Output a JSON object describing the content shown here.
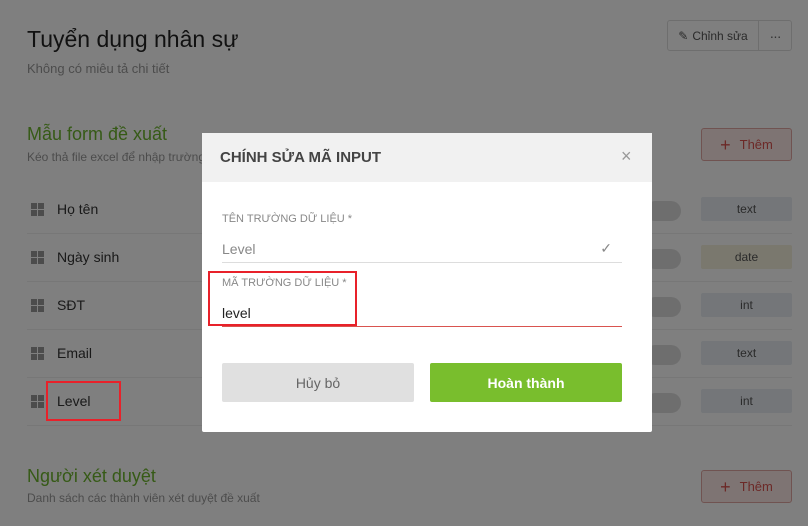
{
  "page": {
    "title": "Tuyển dụng nhân sự",
    "subtitle": "Không có miêu tả chi tiết",
    "edit_label": "Chỉnh sửa",
    "more_label": "···"
  },
  "form_section": {
    "title": "Mẫu form đề xuất",
    "subtitle": "Kéo thả file excel để nhập trường",
    "add_label": "Thêm",
    "fields": [
      {
        "name": "Họ tên",
        "type": "text"
      },
      {
        "name": "Ngày sinh",
        "type": "date"
      },
      {
        "name": "SĐT",
        "type": "int"
      },
      {
        "name": "Email",
        "type": "text"
      },
      {
        "name": "Level",
        "type": "int"
      }
    ]
  },
  "approver_section": {
    "title": "Người xét duyệt",
    "subtitle": "Danh sách các thành viên xét duyệt đề xuất",
    "add_label": "Thêm"
  },
  "modal": {
    "title": "CHÍNH SỬA MÃ INPUT",
    "close_icon": "×",
    "field_name_label": "TÊN TRƯỜNG DỮ LIỆU *",
    "field_name_value": "Level",
    "check_icon": "✓",
    "field_code_label": "MÃ TRƯỜNG DỮ LIỆU *",
    "field_code_value": "level",
    "cancel_label": "Hủy bỏ",
    "done_label": "Hoàn thành"
  },
  "colors": {
    "accent_green": "#79be2d",
    "highlight_red": "#e8212a",
    "danger": "#d9534f"
  }
}
